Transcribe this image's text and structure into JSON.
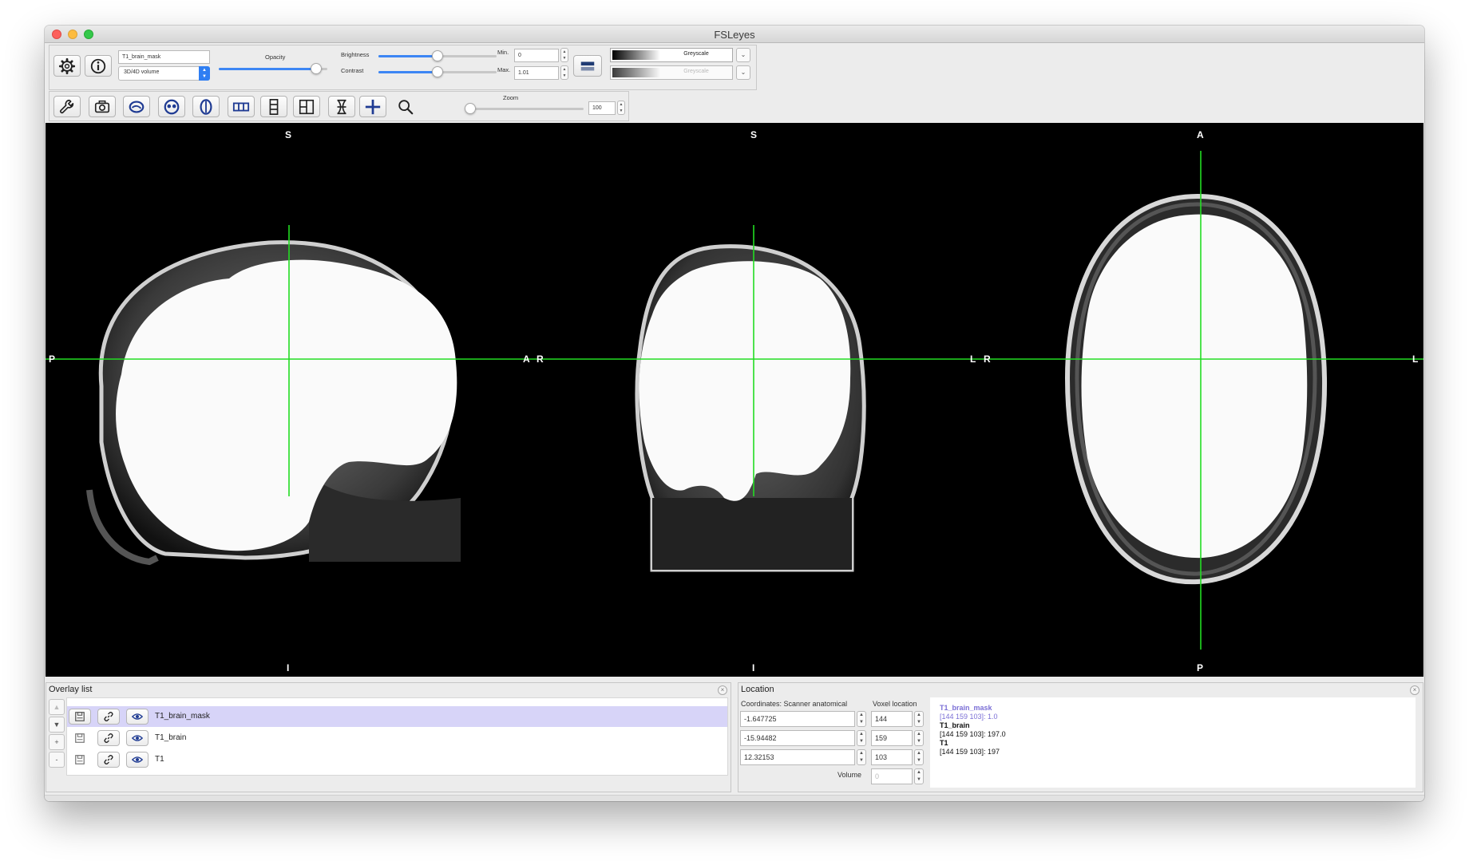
{
  "window": {
    "title": "FSLeyes"
  },
  "toolbar1": {
    "overlay_name": "T1_brain_mask",
    "overlay_type": "3D/4D volume",
    "opacity_label": "Opacity",
    "brightness_label": "Brightness",
    "contrast_label": "Contrast",
    "min_label": "Min.",
    "max_label": "Max.",
    "min_value": "0",
    "max_value": "1.01",
    "colormap_1": "Greyscale",
    "colormap_2": "Greyscale",
    "opacity_level": 0.9,
    "brightness_level": 0.5,
    "contrast_level": 0.5
  },
  "toolbar2": {
    "zoom_label": "Zoom",
    "zoom_value": "100",
    "zoom_level": 0.0
  },
  "views": {
    "sagittal": {
      "top": "S",
      "bottom": "I",
      "left": "P",
      "right": "A"
    },
    "coronal": {
      "top": "S",
      "bottom": "I",
      "left": "R",
      "right": "L"
    },
    "axial": {
      "top": "A",
      "bottom": "P",
      "left": "R",
      "right": "L"
    },
    "cursor_color": "#22dd22"
  },
  "overlay_list": {
    "title": "Overlay list",
    "items": [
      {
        "name": "T1_brain_mask",
        "selected": true
      },
      {
        "name": "T1_brain",
        "selected": false
      },
      {
        "name": "T1",
        "selected": false
      }
    ]
  },
  "location": {
    "title": "Location",
    "coords_label": "Coordinates: Scanner anatomical",
    "voxel_label": "Voxel location",
    "volume_label": "Volume",
    "world": [
      "-1.647725",
      "-15.94482",
      "12.32153"
    ],
    "voxel": [
      "144",
      "159",
      "103"
    ],
    "volume": "0",
    "info": [
      {
        "text": "T1_brain_mask",
        "color": "#7b6fd6",
        "bold": true
      },
      {
        "text": "[144 159 103]: 1.0",
        "color": "#7b6fd6",
        "bold": false
      },
      {
        "text": "T1_brain",
        "color": "#111111",
        "bold": true
      },
      {
        "text": "[144 159 103]: 197.0",
        "color": "#111111",
        "bold": false
      },
      {
        "text": "T1",
        "color": "#111111",
        "bold": true
      },
      {
        "text": "[144 159 103]: 197",
        "color": "#111111",
        "bold": false
      }
    ]
  }
}
